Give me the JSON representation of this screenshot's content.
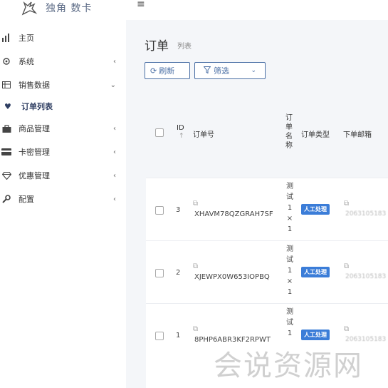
{
  "brand": {
    "name": "独角 数卡"
  },
  "topbar": {
    "menu_icon": "hamburger-icon"
  },
  "sidebar": {
    "items": [
      {
        "label": "主页",
        "icon": "bar-chart-icon",
        "arrow": ""
      },
      {
        "label": "系统",
        "icon": "gear-icon",
        "arrow": "‹"
      },
      {
        "label": "销售数据",
        "icon": "table-icon",
        "arrow": "⌄"
      },
      {
        "label": "订单列表",
        "icon": "heart-icon",
        "arrow": ""
      },
      {
        "label": "商品管理",
        "icon": "shopping-bag-icon",
        "arrow": "‹"
      },
      {
        "label": "卡密管理",
        "icon": "credit-card-icon",
        "arrow": "‹"
      },
      {
        "label": "优惠管理",
        "icon": "diamond-icon",
        "arrow": "‹"
      },
      {
        "label": "配置",
        "icon": "wrench-icon",
        "arrow": "‹"
      }
    ]
  },
  "page": {
    "title": "订单",
    "subtitle": "列表"
  },
  "toolbar": {
    "refresh_label": "刷新",
    "filter_label": "筛选"
  },
  "table": {
    "headers": {
      "id": "ID",
      "order_no": "订单号",
      "order_name": "订\n单\n名\n称",
      "order_type": "订单类型",
      "email": "下单邮箱"
    },
    "rows": [
      {
        "id": "3",
        "order_no": "XHAVM78QZGRAH7SF",
        "name_lines": [
          "测",
          "试",
          "1",
          "×",
          "1"
        ],
        "type": "人工处理",
        "email": "2063105183"
      },
      {
        "id": "2",
        "order_no": "XJEWPX0W653IOPBQ",
        "name_lines": [
          "测",
          "试",
          "1",
          "×",
          "1"
        ],
        "type": "人工处理",
        "email": "2063105183"
      },
      {
        "id": "1",
        "order_no": "8PHP6ABR3KF2RPWT",
        "name_lines": [
          "测",
          "试",
          "1"
        ],
        "type": "人工处理",
        "email": "2063105183"
      }
    ]
  },
  "watermark": "会说资源网"
}
